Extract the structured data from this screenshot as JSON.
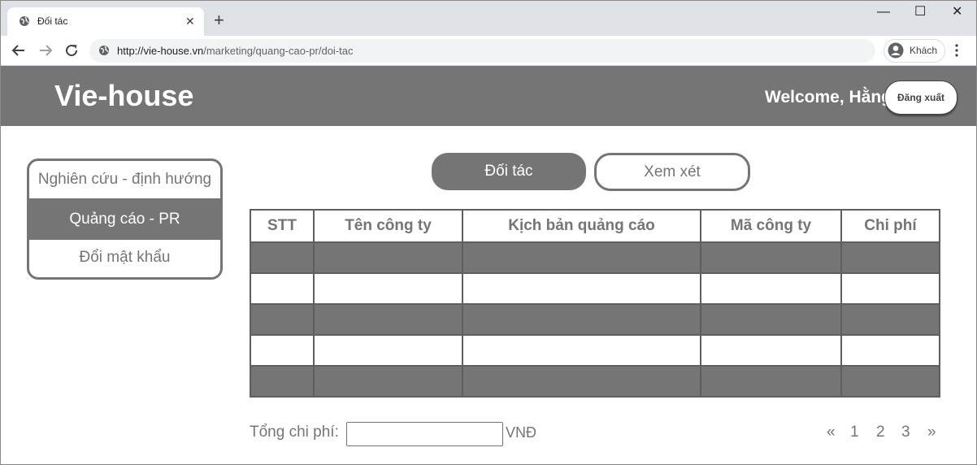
{
  "browser": {
    "tab_title": "Đối tác",
    "tab_close": "✕",
    "new_tab": "+",
    "url_host": "http://vie-house.vn",
    "url_path": "/marketing/quang-cao-pr/doi-tac",
    "profile_label": "Khách",
    "window": {
      "minimize": "—",
      "maximize": "☐",
      "close": "✕"
    }
  },
  "header": {
    "brand": "Vie-house",
    "welcome": "Welcome, Hằng",
    "logout_label": "Đăng xuất"
  },
  "sidebar": {
    "items": [
      {
        "label": "Nghiên cứu - định hướng",
        "active": false
      },
      {
        "label": "Quảng cáo - PR",
        "active": true
      },
      {
        "label": "Đổi mật khẩu",
        "active": false
      }
    ]
  },
  "tabs": {
    "partners_label": "Đối tác",
    "review_label": "Xem xét"
  },
  "table": {
    "headers": [
      "STT",
      "Tên công ty",
      "Kịch bản quảng cáo",
      "Mã công ty",
      "Chi phí"
    ],
    "rows": [
      [
        "",
        "",
        "",
        "",
        ""
      ],
      [
        "",
        "",
        "",
        "",
        ""
      ],
      [
        "",
        "",
        "",
        "",
        ""
      ],
      [
        "",
        "",
        "",
        "",
        ""
      ],
      [
        "",
        "",
        "",
        "",
        ""
      ]
    ]
  },
  "footer": {
    "total_label": "Tổng chi phí:",
    "total_value": "",
    "currency": "VNĐ",
    "pager": {
      "prev": "«",
      "pages": [
        "1",
        "2",
        "3"
      ],
      "next": "»"
    }
  },
  "colors": {
    "accent": "#757575",
    "header_bg": "#757575",
    "browser_chrome": "#dee1e6"
  }
}
